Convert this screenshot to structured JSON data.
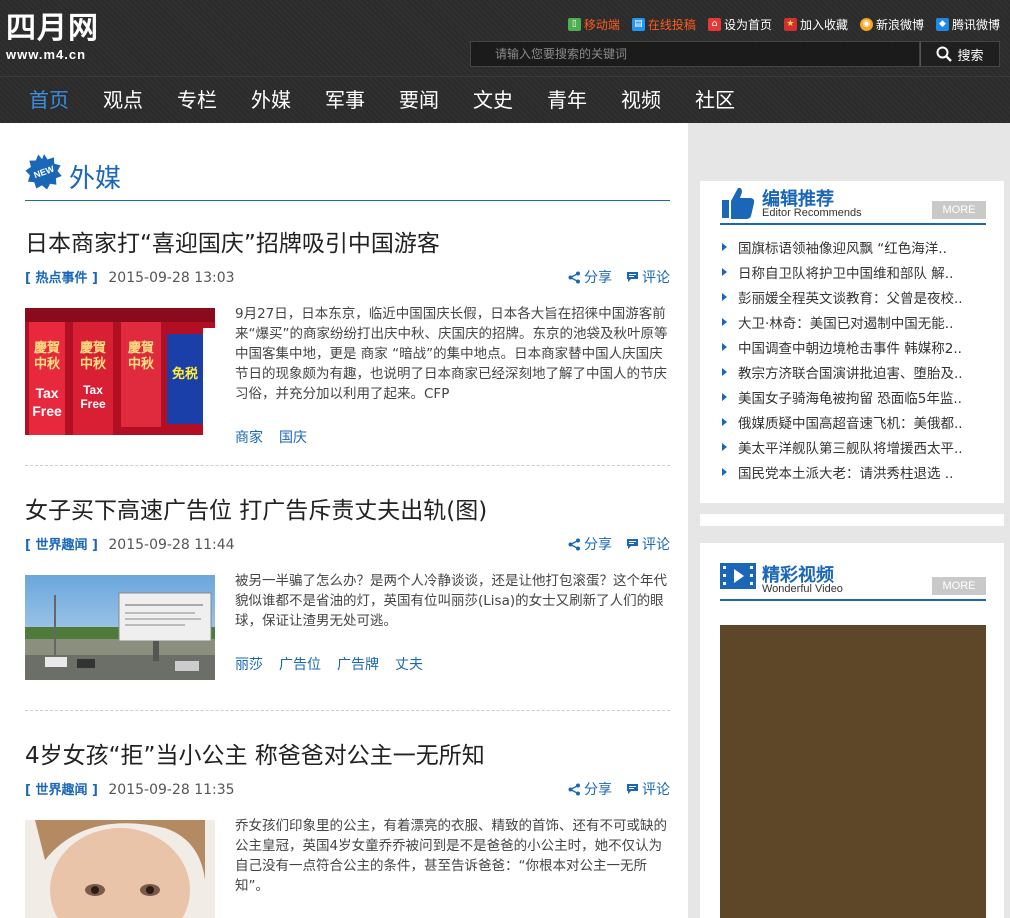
{
  "logo": {
    "name": "四月网",
    "url": "www.m4.cn"
  },
  "top_links": [
    {
      "label": "移动端",
      "icon": "mobile-icon",
      "color": "#4caf50",
      "highlight": true
    },
    {
      "label": "在线投稿",
      "icon": "submit-icon",
      "color": "#2196f3",
      "highlight": true
    },
    {
      "label": "设为首页",
      "icon": "home-icon",
      "color": "#e53935",
      "highlight": false
    },
    {
      "label": "加入收藏",
      "icon": "star-icon",
      "color": "#d32f2f",
      "highlight": false
    },
    {
      "label": "新浪微博",
      "icon": "weibo-icon",
      "color": "#f5a623",
      "highlight": false
    },
    {
      "label": "腾讯微博",
      "icon": "tencent-weibo-icon",
      "color": "#1e88e5",
      "highlight": false
    }
  ],
  "search": {
    "placeholder": "请输入您要搜索的关键词",
    "button": "搜索"
  },
  "nav": [
    "首页",
    "观点",
    "专栏",
    "外媒",
    "军事",
    "要闻",
    "文史",
    "青年",
    "视频",
    "社区"
  ],
  "section": {
    "badge": "NEW",
    "title": "外媒"
  },
  "share_label": "分享",
  "comment_label": "评论",
  "articles": [
    {
      "title": "日本商家打“喜迎国庆”招牌吸引中国游客",
      "category": "[ 热点事件 ]",
      "date": "2015-09-28 13:03",
      "excerpt": "9月27日，日本东京，临近中国国庆长假，日本各大旨在招徕中国游客前来“爆买”的商家纷纷打出庆中秋、庆国庆的招牌。东京的池袋及秋叶原等中国客集中地，更是 商家 “暗战”的集中地点。日本商家替中国人庆国庆节日的现象颇为有趣，也说明了日本商家已经深刻地了解了中国人的节庆习俗，并充分加以利用了起来。CFP",
      "tags": [
        "商家",
        "国庆"
      ],
      "image_text": [
        "慶賀",
        "中秋",
        "Tax",
        "Free",
        "免税"
      ]
    },
    {
      "title": "女子买下高速广告位 打广告斥责丈夫出轨(图)",
      "category": "[ 世界趣闻 ]",
      "date": "2015-09-28 11:44",
      "excerpt": "被另一半骗了怎么办？是两个人冷静谈谈，还是让他打包滚蛋？这个年代貌似谁都不是省油的灯，英国有位叫丽莎(Lisa)的女士又刷新了人们的眼球，保证让渣男无处可逃。",
      "tags": [
        "丽莎",
        "广告位",
        "广告牌",
        "丈夫"
      ]
    },
    {
      "title": "4岁女孩“拒”当小公主 称爸爸对公主一无所知",
      "category": "[ 世界趣闻 ]",
      "date": "2015-09-28 11:35",
      "excerpt": "乔女孩们印象里的公主，有着漂亮的衣服、精致的首饰、还有不可或缺的公主皇冠，英国4岁女童乔乔被问到是不是爸爸的小公主时，她不仅认为自己没有一点符合公主的条件，甚至告诉爸爸：“你根本对公主一无所知”。",
      "tags": []
    }
  ],
  "editor_panel": {
    "title": "编辑推荐",
    "subtitle": "Editor Recommends",
    "more": "MORE",
    "items": [
      "国旗标语领袖像迎风飘 “红色海洋..",
      "日称自卫队将护卫中国维和部队 解..",
      "彭丽媛全程英文谈教育：父曾是夜校..",
      "大卫·林奇：美国已对遏制中国无能..",
      "中国调查中朝边境枪击事件 韩媒称2..",
      "教宗方济联合国演讲批迫害、堕胎及..",
      "美国女子骑海龟被拘留 恐面临5年监..",
      "俄媒质疑中国高超音速飞机：美俄都..",
      "美太平洋舰队第三舰队将增援西太平..",
      "国民党本土派大老：请洪秀柱退选 .."
    ]
  },
  "video_panel": {
    "title": "精彩视频",
    "subtitle": "Wonderful Video",
    "more": "MORE"
  }
}
